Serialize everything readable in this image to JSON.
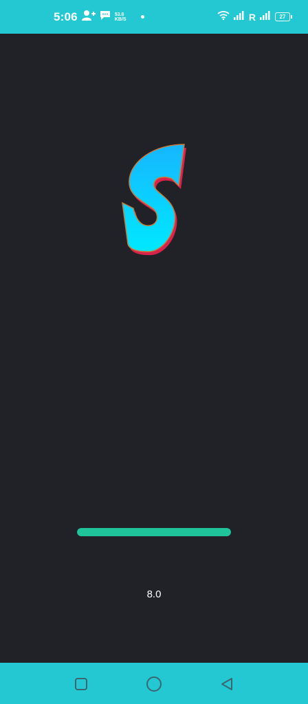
{
  "status_bar": {
    "time": "5:06",
    "network_speed_value": "53.8",
    "network_speed_unit": "KB/S",
    "carrier_label": "R",
    "battery_level": "27",
    "background": "#23c8d2",
    "icons": [
      "person-add-icon",
      "chat-icon",
      "wifi-icon",
      "signal-icon",
      "battery-icon"
    ]
  },
  "splash": {
    "logo_letter": "S",
    "progress_fraction": 1.0,
    "progress_color": "#1fc49a",
    "version": "8.0",
    "background": "#202227"
  },
  "nav_bar": {
    "buttons": [
      "recents-square-icon",
      "home-circle-icon",
      "back-triangle-icon"
    ],
    "background": "#23c8d2"
  }
}
